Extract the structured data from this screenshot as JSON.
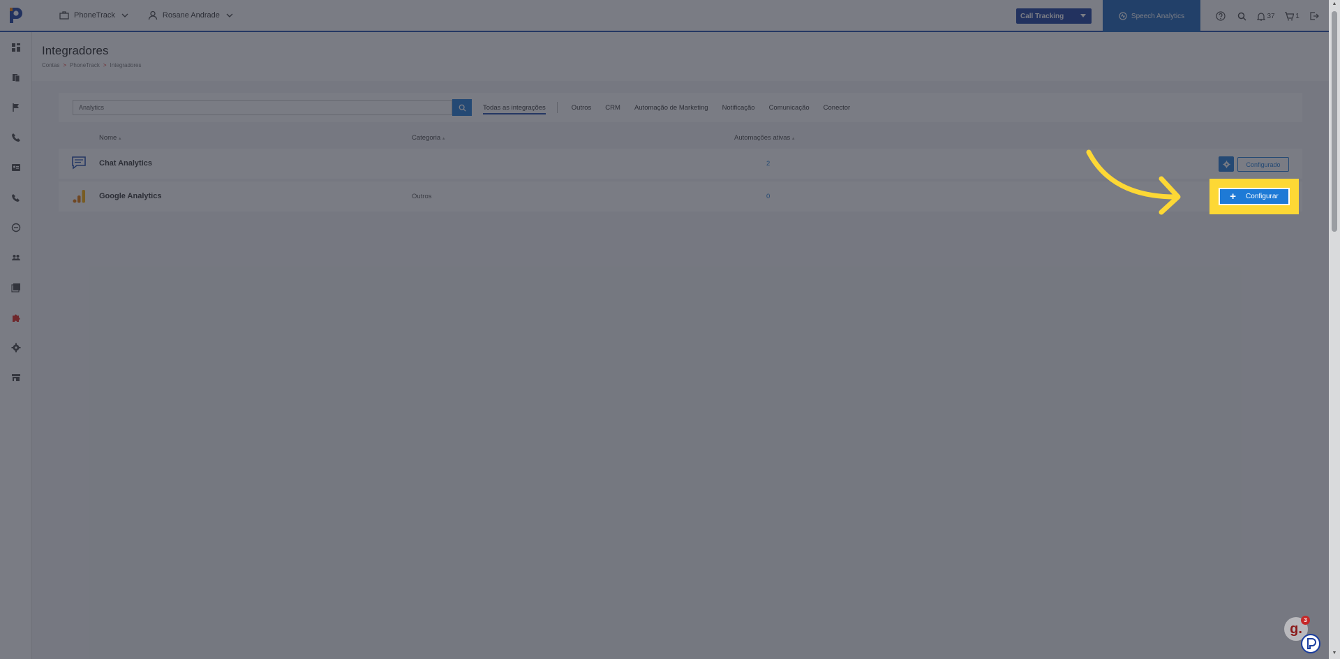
{
  "topbar": {
    "account_menu": "PhoneTrack",
    "user_menu": "Rosane Andrade",
    "product_select": "Call Tracking",
    "speech_label": "Speech Analytics",
    "notifications_count": "37",
    "cart_count": "1"
  },
  "sidebar": {
    "items": [
      "dashboard-icon",
      "documents-icon",
      "flag-icon",
      "phone-icon",
      "contact-card-icon",
      "phone-outgoing-icon",
      "minus-circle-icon",
      "users-icon",
      "reports-icon",
      "puzzle-icon",
      "gear-icon",
      "store-icon"
    ],
    "active_item": "puzzle-icon",
    "active_color": "#e2231a"
  },
  "page": {
    "title": "Integradores",
    "breadcrumb": [
      "Contas",
      "PhoneTrack",
      "Integradores"
    ],
    "breadcrumb_sep": ">"
  },
  "filters": {
    "search_value": "Analytics",
    "tabs": [
      "Todas as integrações",
      "Outros",
      "CRM",
      "Automação de Marketing",
      "Notificação",
      "Comunicação",
      "Conector"
    ],
    "active_tab": "Todas as integrações"
  },
  "table": {
    "headers": [
      "Nome",
      "Categoria",
      "Automações ativas"
    ],
    "rows": [
      {
        "icon": "chat-icon",
        "name": "Chat Analytics",
        "category": "",
        "active_automations": "2",
        "status_label": "Configurado"
      },
      {
        "icon": "bar-chart-icon",
        "name": "Google Analytics",
        "category": "Outros",
        "active_automations": "0",
        "action_label": "Configurar"
      }
    ]
  },
  "widgets": {
    "assistant_glyph": "g.",
    "assistant_badge": "3"
  },
  "colors": {
    "brand_blue": "#1e7ad6",
    "dark_blue": "#1a3d9e",
    "highlight": "#fdd835"
  }
}
